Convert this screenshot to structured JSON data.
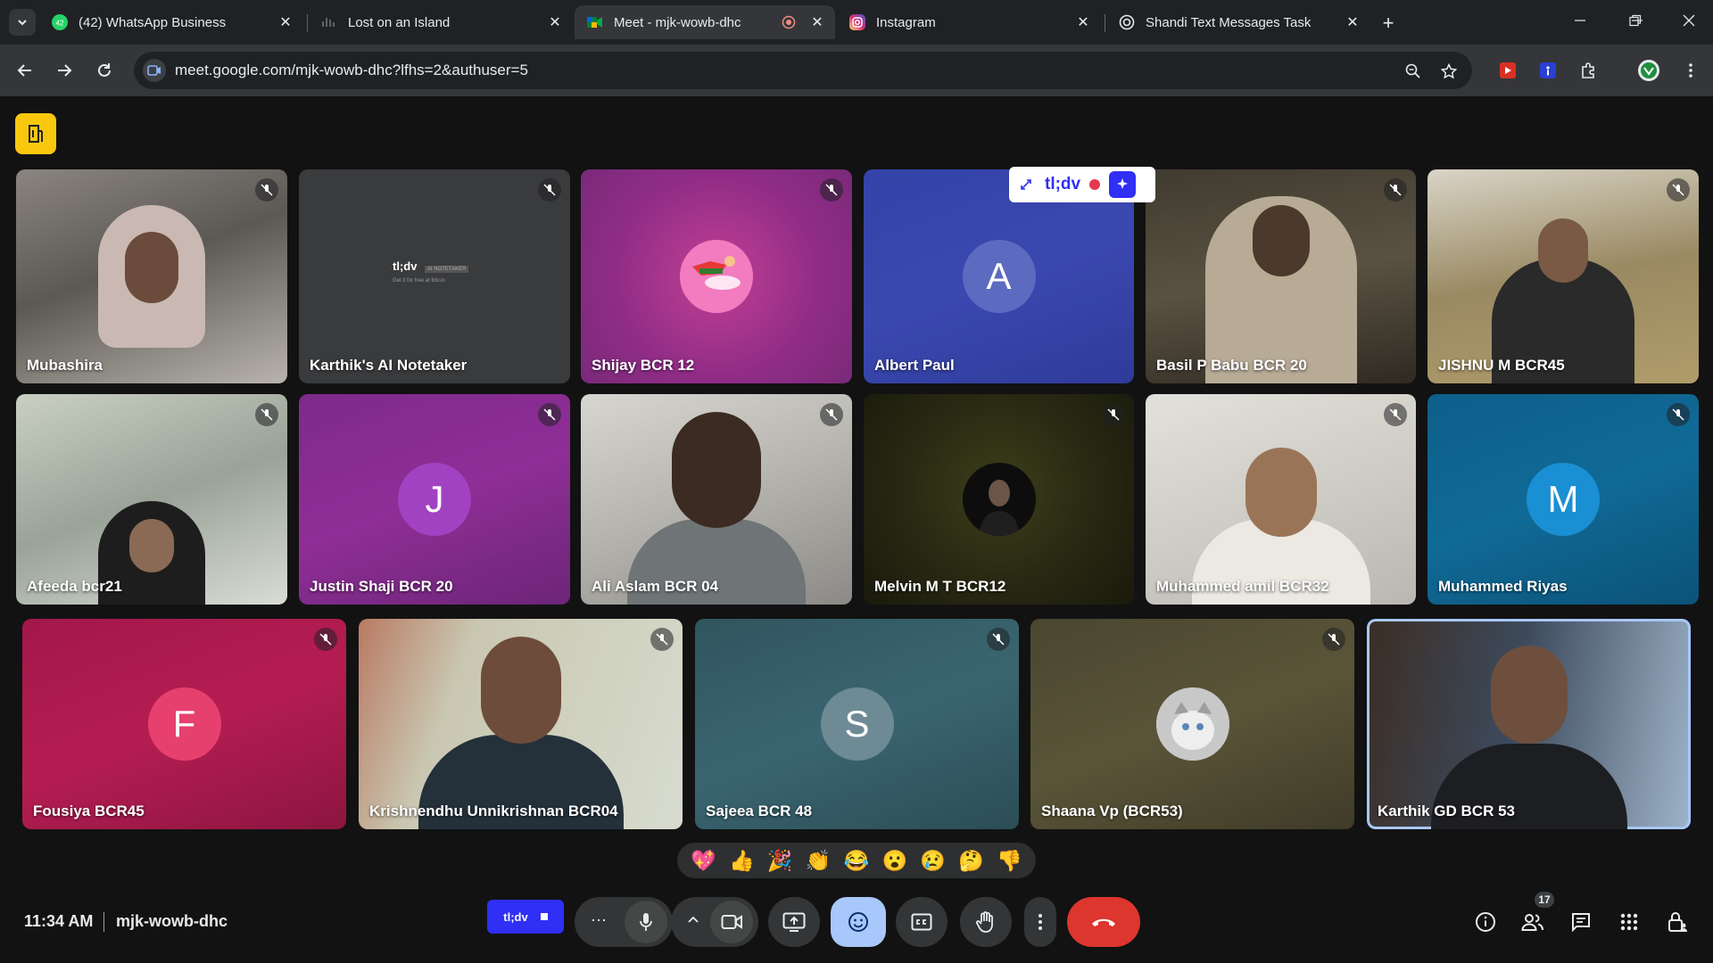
{
  "browser": {
    "tabs": [
      {
        "title": "(42) WhatsApp Business",
        "badge": "42"
      },
      {
        "title": "Lost on an Island"
      },
      {
        "title": "Meet - mjk-wowb-dhc"
      },
      {
        "title": "Instagram"
      },
      {
        "title": "Shandi Text Messages Task"
      }
    ],
    "url": "meet.google.com/mjk-wowb-dhc?lfhs=2&authuser=5"
  },
  "tldv_overlay": {
    "label": "tl;dv"
  },
  "participants": [
    {
      "name": "Mubashira",
      "type": "video"
    },
    {
      "name": "Karthik's AI Notetaker",
      "type": "notetaker",
      "card_title": "tl;dv",
      "card_badge": "AI NOTETAKER",
      "card_sub": "Get it for free at tldv.io"
    },
    {
      "name": "Shijay BCR 12",
      "type": "avatar-image"
    },
    {
      "name": "Albert Paul",
      "type": "avatar",
      "initial": "A",
      "color": "#5c6bc0"
    },
    {
      "name": "Basil P Babu BCR 20",
      "type": "video"
    },
    {
      "name": "JISHNU M BCR45",
      "type": "video"
    },
    {
      "name": "Afeeda bcr21",
      "type": "video"
    },
    {
      "name": "Justin Shaji BCR 20",
      "type": "avatar",
      "initial": "J",
      "color": "#a142c2"
    },
    {
      "name": "Ali Aslam BCR 04",
      "type": "video"
    },
    {
      "name": "Melvin M T BCR12",
      "type": "avatar-image"
    },
    {
      "name": "Muhammed amil BCR32",
      "type": "video"
    },
    {
      "name": "Muhammed Riyas",
      "type": "avatar",
      "initial": "M",
      "color": "#1a8fd4"
    },
    {
      "name": "Fousiya BCR45",
      "type": "avatar",
      "initial": "F",
      "color": "#e6406f"
    },
    {
      "name": "Krishnendhu Unnikrishnan BCR04",
      "type": "video"
    },
    {
      "name": "Sajeea BCR 48",
      "type": "avatar",
      "initial": "S",
      "color": "#6e8a95"
    },
    {
      "name": "Shaana Vp (BCR53)",
      "type": "avatar-image"
    },
    {
      "name": "Karthik GD BCR 53",
      "type": "video"
    }
  ],
  "reactions": [
    "💖",
    "👍",
    "🎉",
    "👏",
    "😂",
    "😮",
    "😢",
    "🤔",
    "👎"
  ],
  "bottom": {
    "time": "11:34 AM",
    "meeting_code": "mjk-wowb-dhc",
    "tldv_button": "tl;dv",
    "people_count": "17"
  }
}
